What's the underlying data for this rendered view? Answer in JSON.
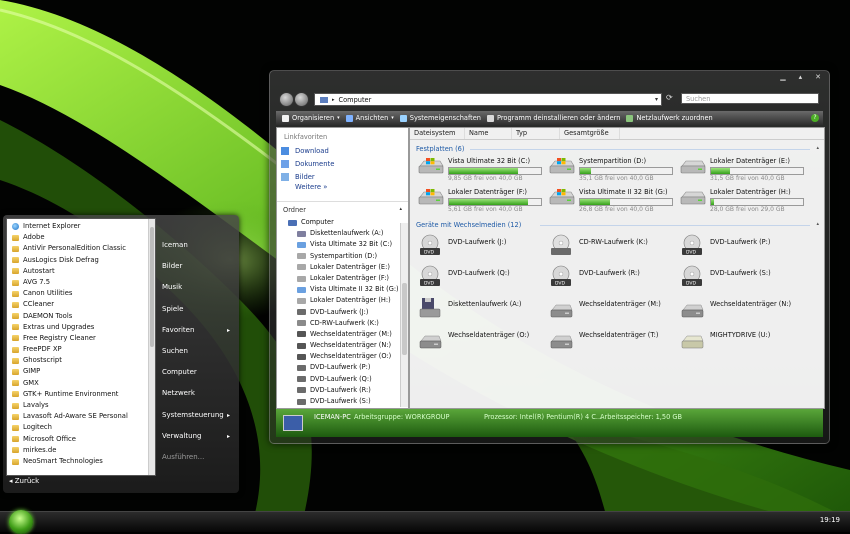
{
  "colors": {
    "accent": "#46a12a",
    "folder": "#e8b948",
    "link": "#1a3c8c",
    "group_header": "#1e5aa6"
  },
  "start_menu": {
    "programs": [
      {
        "label": "Internet Explorer",
        "icon": "ie-icon"
      },
      {
        "label": "Adobe",
        "icon": "folder-icon"
      },
      {
        "label": "AntiVir PersonalEdition Classic",
        "icon": "folder-icon"
      },
      {
        "label": "AusLogics Disk Defrag",
        "icon": "folder-icon"
      },
      {
        "label": "Autostart",
        "icon": "folder-icon"
      },
      {
        "label": "AVG 7.5",
        "icon": "folder-icon"
      },
      {
        "label": "Canon Utilities",
        "icon": "folder-icon"
      },
      {
        "label": "CCleaner",
        "icon": "folder-icon"
      },
      {
        "label": "DAEMON Tools",
        "icon": "folder-icon"
      },
      {
        "label": "Extras und Upgrades",
        "icon": "folder-icon"
      },
      {
        "label": "Free Registry Cleaner",
        "icon": "folder-icon"
      },
      {
        "label": "FreePDF XP",
        "icon": "folder-icon"
      },
      {
        "label": "Ghostscript",
        "icon": "folder-icon"
      },
      {
        "label": "GIMP",
        "icon": "folder-icon"
      },
      {
        "label": "GMX",
        "icon": "folder-icon"
      },
      {
        "label": "GTK+ Runtime Environment",
        "icon": "folder-icon"
      },
      {
        "label": "Lavalys",
        "icon": "folder-icon"
      },
      {
        "label": "Lavasoft Ad-Aware SE Personal",
        "icon": "folder-icon"
      },
      {
        "label": "Logitech",
        "icon": "folder-icon"
      },
      {
        "label": "Microsoft Office",
        "icon": "folder-icon"
      },
      {
        "label": "mirkes.de",
        "icon": "folder-icon"
      },
      {
        "label": "NeoSmart Technologies",
        "icon": "folder-icon"
      }
    ],
    "back_label": "Zurück",
    "right_items": [
      {
        "label": "Iceman",
        "submenu": false,
        "dim": false
      },
      {
        "label": "Bilder",
        "submenu": false,
        "dim": false
      },
      {
        "label": "Musik",
        "submenu": false,
        "dim": false
      },
      {
        "label": "Spiele",
        "submenu": false,
        "dim": false
      },
      {
        "label": "Favoriten",
        "submenu": true,
        "dim": false
      },
      {
        "label": "Suchen",
        "submenu": false,
        "dim": false
      },
      {
        "label": "Computer",
        "submenu": false,
        "dim": false
      },
      {
        "label": "Netzwerk",
        "submenu": false,
        "dim": false
      },
      {
        "label": "Systemsteuerung",
        "submenu": true,
        "dim": false
      },
      {
        "label": "Verwaltung",
        "submenu": true,
        "dim": false
      },
      {
        "label": "Ausführen...",
        "submenu": false,
        "dim": true
      }
    ]
  },
  "taskbar": {
    "clock": "19:19"
  },
  "explorer": {
    "address": "Computer",
    "search_placeholder": "Suchen",
    "toolbar": [
      {
        "label": "Organisieren",
        "dropdown": true,
        "icon": "organize-icon"
      },
      {
        "label": "Ansichten",
        "dropdown": true,
        "icon": "views-icon"
      },
      {
        "label": "Systemeigenschaften",
        "dropdown": false,
        "icon": "system-properties-icon"
      },
      {
        "label": "Programm deinstallieren oder ändern",
        "dropdown": false,
        "icon": "uninstall-icon"
      },
      {
        "label": "Netzlaufwerk zuordnen",
        "dropdown": false,
        "icon": "map-drive-icon"
      }
    ],
    "nav": {
      "links_header": "Linkfavoriten",
      "links": [
        {
          "label": "Download",
          "icon": "download-folder-icon"
        },
        {
          "label": "Dokumente",
          "icon": "documents-icon"
        },
        {
          "label": "Bilder",
          "icon": "pictures-icon"
        }
      ],
      "more": "Weitere",
      "folders_header": "Ordner",
      "tree": [
        {
          "label": "Computer",
          "icon": "computer-icon",
          "indent": 1
        },
        {
          "label": "Diskettenlaufwerk (A:)",
          "icon": "floppy-icon",
          "indent": 2
        },
        {
          "label": "Vista Ultimate 32 Bit (C:)",
          "icon": "windows-drive-icon",
          "indent": 2
        },
        {
          "label": "Systempartition (D:)",
          "icon": "hard-drive-icon",
          "indent": 2
        },
        {
          "label": "Lokaler Datenträger (E:)",
          "icon": "hard-drive-icon",
          "indent": 2
        },
        {
          "label": "Lokaler Datenträger (F:)",
          "icon": "hard-drive-icon",
          "indent": 2
        },
        {
          "label": "Vista Ultimate II 32 Bit (G:)",
          "icon": "windows-drive-icon",
          "indent": 2
        },
        {
          "label": "Lokaler Datenträger (H:)",
          "icon": "hard-drive-icon",
          "indent": 2
        },
        {
          "label": "DVD-Laufwerk (J:)",
          "icon": "dvd-drive-icon",
          "indent": 2
        },
        {
          "label": "CD-RW-Laufwerk (K:)",
          "icon": "cd-drive-icon",
          "indent": 2
        },
        {
          "label": "Wechseldatenträger (M:)",
          "icon": "removable-drive-icon",
          "indent": 2
        },
        {
          "label": "Wechseldatenträger (N:)",
          "icon": "removable-drive-icon",
          "indent": 2
        },
        {
          "label": "Wechseldatenträger (O:)",
          "icon": "removable-drive-icon",
          "indent": 2
        },
        {
          "label": "DVD-Laufwerk (P:)",
          "icon": "dvd-drive-icon",
          "indent": 2
        },
        {
          "label": "DVD-Laufwerk (Q:)",
          "icon": "dvd-drive-icon",
          "indent": 2
        },
        {
          "label": "DVD-Laufwerk (R:)",
          "icon": "dvd-drive-icon",
          "indent": 2
        },
        {
          "label": "DVD-Laufwerk (S:)",
          "icon": "dvd-drive-icon",
          "indent": 2
        }
      ]
    },
    "columns": [
      "Dateisystem",
      "Name",
      "Typ",
      "Gesamtgröße"
    ],
    "groups": {
      "hard_disks": "Festplatten (6)",
      "removable": "Geräte mit Wechselmedien (12)"
    },
    "drives": [
      {
        "name": "Vista Ultimate 32 Bit (C:)",
        "free": "9,85 GB frei von 40,0 GB",
        "used_fraction": 0.75,
        "windows": true
      },
      {
        "name": "Systempartition (D:)",
        "free": "35,1 GB frei von 40,0 GB",
        "used_fraction": 0.12,
        "windows": true
      },
      {
        "name": "Lokaler Datenträger (E:)",
        "free": "31,5 GB frei von 40,0 GB",
        "used_fraction": 0.21,
        "windows": false
      },
      {
        "name": "Lokaler Datenträger (F:)",
        "free": "5,61 GB frei von 40,0 GB",
        "used_fraction": 0.86,
        "windows": true
      },
      {
        "name": "Vista Ultimate II 32 Bit (G:)",
        "free": "26,8 GB frei von 40,0 GB",
        "used_fraction": 0.33,
        "windows": true
      },
      {
        "name": "Lokaler Datenträger (H:)",
        "free": "28,0 GB frei von 29,0 GB",
        "used_fraction": 0.03,
        "windows": false
      }
    ],
    "media": [
      {
        "name": "DVD-Laufwerk (J:)",
        "kind": "dvd"
      },
      {
        "name": "CD-RW-Laufwerk (K:)",
        "kind": "cd"
      },
      {
        "name": "DVD-Laufwerk (P:)",
        "kind": "dvd"
      },
      {
        "name": "DVD-Laufwerk (Q:)",
        "kind": "dvd"
      },
      {
        "name": "DVD-Laufwerk (R:)",
        "kind": "dvd"
      },
      {
        "name": "DVD-Laufwerk (S:)",
        "kind": "dvd"
      },
      {
        "name": "Diskettenlaufwerk (A:)",
        "kind": "floppy"
      },
      {
        "name": "Wechseldatenträger (M:)",
        "kind": "removable"
      },
      {
        "name": "Wechseldatenträger (N:)",
        "kind": "removable"
      },
      {
        "name": "Wechseldatenträger (O:)",
        "kind": "removable"
      },
      {
        "name": "Wechseldatenträger (T:)",
        "kind": "removable"
      },
      {
        "name": "MIGHTYDRIVE (U:)",
        "kind": "usb"
      }
    ],
    "details": {
      "pc_name": "ICEMAN-PC",
      "workgroup": "Arbeitsgruppe: WORKGROUP",
      "processor": "Prozessor: Intel(R) Pentium(R) 4 C...",
      "memory": "Arbeitsspeicher: 1,50 GB"
    }
  }
}
